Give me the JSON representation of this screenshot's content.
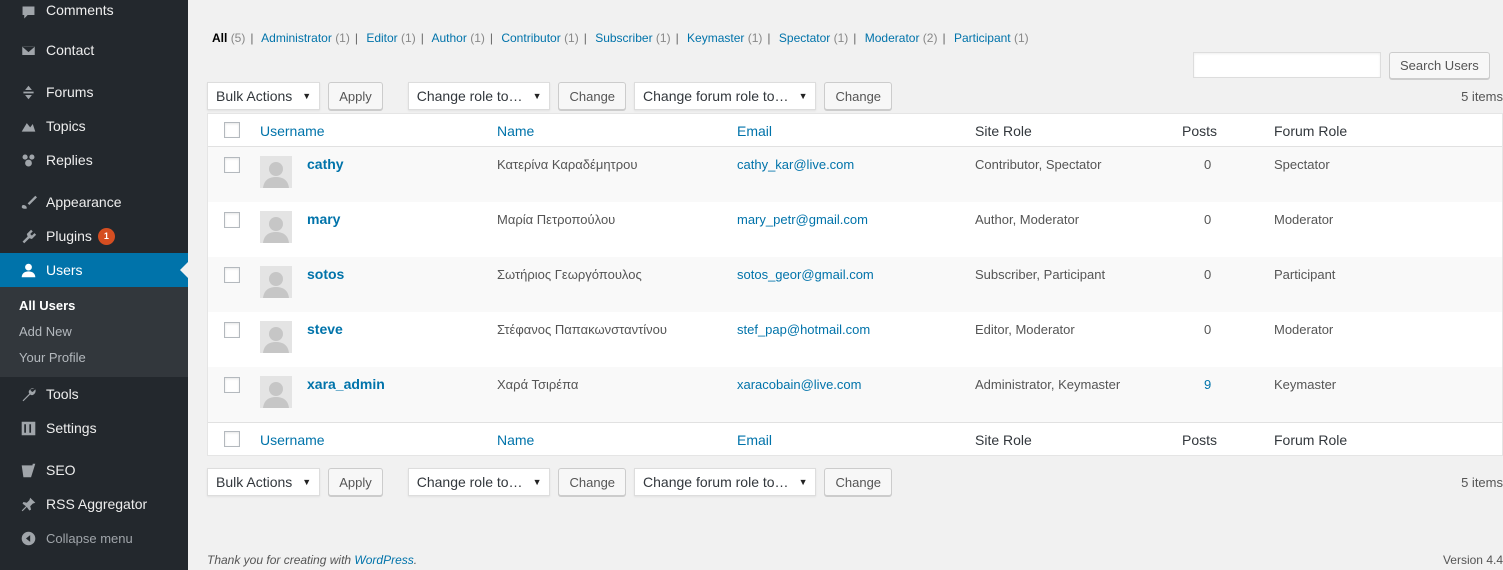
{
  "sidebar": {
    "items": [
      {
        "label": "Comments",
        "icon": "comment-icon"
      },
      {
        "label": "Contact",
        "icon": "mail-icon"
      },
      {
        "label": "Forums",
        "icon": "forums-icon"
      },
      {
        "label": "Topics",
        "icon": "topics-icon"
      },
      {
        "label": "Replies",
        "icon": "replies-icon"
      },
      {
        "label": "Appearance",
        "icon": "paintbrush-icon"
      },
      {
        "label": "Plugins",
        "icon": "plug-icon",
        "badge": "1"
      },
      {
        "label": "Users",
        "icon": "users-icon"
      },
      {
        "label": "Tools",
        "icon": "wrench-icon"
      },
      {
        "label": "Settings",
        "icon": "settings-icon"
      },
      {
        "label": "SEO",
        "icon": "seo-icon"
      },
      {
        "label": "RSS Aggregator",
        "icon": "pin-icon"
      },
      {
        "label": "Collapse menu",
        "icon": "collapse-icon"
      }
    ],
    "submenu": [
      "All Users",
      "Add New",
      "Your Profile"
    ]
  },
  "filters": [
    {
      "label": "All",
      "count": "(5)"
    },
    {
      "label": "Administrator",
      "count": "(1)"
    },
    {
      "label": "Editor",
      "count": "(1)"
    },
    {
      "label": "Author",
      "count": "(1)"
    },
    {
      "label": "Contributor",
      "count": "(1)"
    },
    {
      "label": "Subscriber",
      "count": "(1)"
    },
    {
      "label": "Keymaster",
      "count": "(1)"
    },
    {
      "label": "Spectator",
      "count": "(1)"
    },
    {
      "label": "Moderator",
      "count": "(2)"
    },
    {
      "label": "Participant",
      "count": "(1)"
    }
  ],
  "search": {
    "button": "Search Users",
    "value": ""
  },
  "tablenav": {
    "bulk_actions": "Bulk Actions",
    "apply": "Apply",
    "change_role": "Change role to…",
    "change": "Change",
    "change_forum_role": "Change forum role to…",
    "items_count": "5 items"
  },
  "table": {
    "columns": [
      "Username",
      "Name",
      "Email",
      "Site Role",
      "Posts",
      "Forum Role"
    ],
    "rows": [
      {
        "username": "cathy",
        "name": "Κατερίνα Καραδέμητρου",
        "email": "cathy_kar@live.com",
        "site_role": "Contributor, Spectator",
        "posts": "0",
        "forum_role": "Spectator"
      },
      {
        "username": "mary",
        "name": "Μαρία Πετροπούλου",
        "email": "mary_petr@gmail.com",
        "site_role": "Author, Moderator",
        "posts": "0",
        "forum_role": "Moderator"
      },
      {
        "username": "sotos",
        "name": "Σωτήριος Γεωργόπουλος",
        "email": "sotos_geor@gmail.com",
        "site_role": "Subscriber, Participant",
        "posts": "0",
        "forum_role": "Participant"
      },
      {
        "username": "steve",
        "name": "Στέφανος Παπακωνσταντίνου",
        "email": "stef_pap@hotmail.com",
        "site_role": "Editor, Moderator",
        "posts": "0",
        "forum_role": "Moderator"
      },
      {
        "username": "xara_admin",
        "name": "Χαρά Τσιρέπα",
        "email": "xaracobain@live.com",
        "site_role": "Administrator, Keymaster",
        "posts": "9",
        "forum_role": "Keymaster"
      }
    ]
  },
  "footer": {
    "thanks_prefix": "Thank you for creating with ",
    "thanks_link": "WordPress",
    "thanks_suffix": ".",
    "version": "Version 4.4"
  },
  "colors": {
    "sidebar": "#23282d",
    "accent": "#0073aa",
    "badge": "#d54e21"
  }
}
